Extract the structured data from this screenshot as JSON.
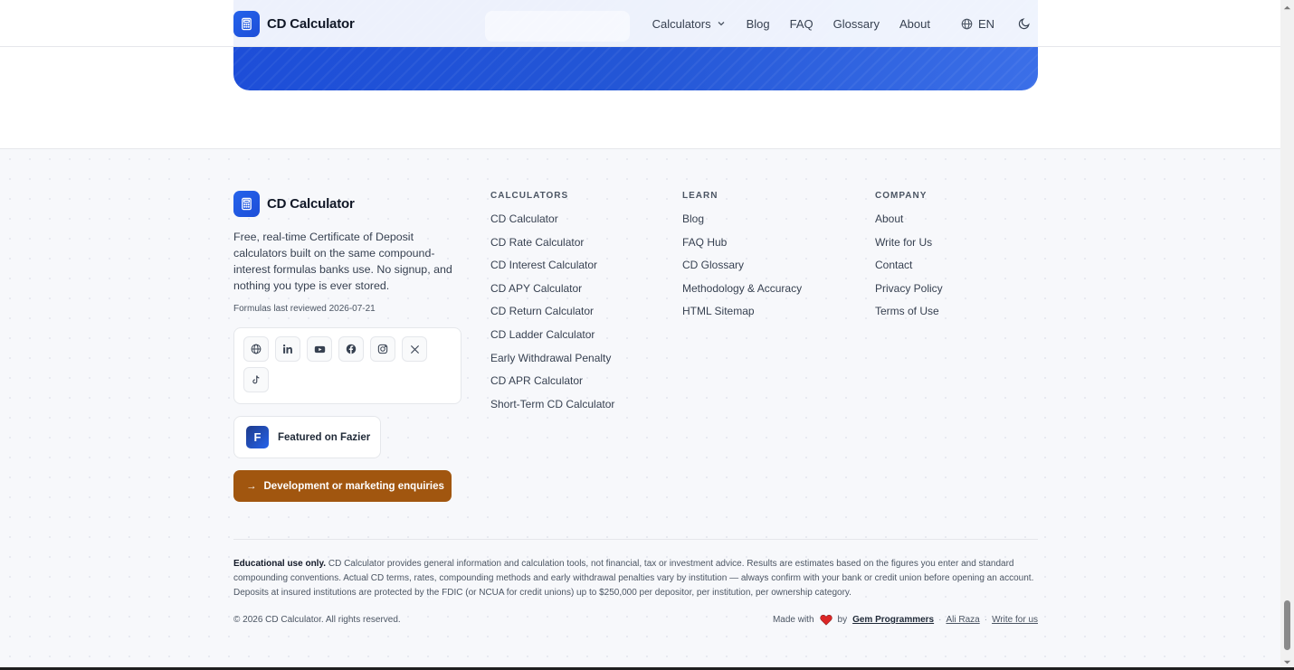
{
  "navbar": {
    "brand": "CD Calculator",
    "links": [
      "Calculators",
      "Blog",
      "FAQ",
      "Glossary",
      "About"
    ],
    "language": "EN"
  },
  "footer": {
    "brand": "CD Calculator",
    "description": "Free, real-time Certificate of Deposit calculators built on the same compound-interest formulas banks use. No signup, and nothing you type is ever stored.",
    "reviewed": "Formulas last reviewed 2026-07-21",
    "social_icons": [
      "globe-icon",
      "linkedin-icon",
      "youtube-icon",
      "facebook-icon",
      "instagram-icon",
      "x-icon",
      "tiktok-icon"
    ],
    "fazier_letter": "F",
    "fazier_label": "Featured on Fazier",
    "enquiry_label": "Development or marketing enquiries",
    "columns": {
      "calculators": {
        "title": "CALCULATORS",
        "items": [
          "CD Calculator",
          "CD Rate Calculator",
          "CD Interest Calculator",
          "CD APY Calculator",
          "CD Return Calculator",
          "CD Ladder Calculator",
          "Early Withdrawal Penalty",
          "CD APR Calculator",
          "Short-Term CD Calculator"
        ]
      },
      "learn": {
        "title": "LEARN",
        "items": [
          "Blog",
          "FAQ Hub",
          "CD Glossary",
          "Methodology & Accuracy",
          "HTML Sitemap"
        ]
      },
      "company": {
        "title": "COMPANY",
        "items": [
          "About",
          "Write for Us",
          "Contact",
          "Privacy Policy",
          "Terms of Use"
        ]
      }
    },
    "disclaimer_lead": "Educational use only.",
    "disclaimer_body": " CD Calculator provides general information and calculation tools, not financial, tax or investment advice. Results are estimates based on the figures you enter and standard compounding conventions. Actual CD terms, rates, compounding methods and early withdrawal penalties vary by institution — always confirm with your bank or credit union before opening an account. Deposits at insured institutions are protected by the FDIC (or NCUA for credit unions) up to $250,000 per depositor, per institution, per ownership category.",
    "copyright": "© 2026 CD Calculator. All rights reserved.",
    "made_with": "Made with",
    "by": "by",
    "credit_company": "Gem Programmers",
    "credit_person": "Ali Raza",
    "credit_write": "Write for us",
    "separator": "·"
  },
  "colors": {
    "accent": "#2563eb",
    "banner": "#1d4ed8",
    "enquiry_button": "#a1560f",
    "heart": "#dc2626"
  }
}
